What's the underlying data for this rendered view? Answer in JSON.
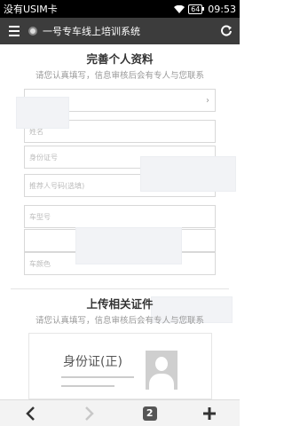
{
  "status_bar": {
    "carrier": "没有USIM卡",
    "battery": "64",
    "time": "09:53"
  },
  "browser": {
    "page_title": "一号专车线上培训系统"
  },
  "form": {
    "title": "完善个人资料",
    "subtitle": "请您认真填写，信息审核后会有专人与您联系",
    "fields": [
      {
        "placeholder": ""
      },
      {
        "placeholder": "姓名"
      },
      {
        "placeholder": "身份证号"
      },
      {
        "placeholder": "推荐人号码(选填)"
      },
      {
        "placeholder": "车型号"
      },
      {
        "placeholder": ""
      },
      {
        "placeholder": "车颜色"
      }
    ]
  },
  "upload": {
    "title": "上传相关证件",
    "subtitle": "请您认真填写，信息审核后会有专人与您联系",
    "card_label": "身份证(正)"
  },
  "toolbar": {
    "tab_count": "2"
  },
  "icons": [
    "menu-icon",
    "site-icon",
    "refresh-icon",
    "back-icon",
    "forward-icon",
    "plus-icon",
    "avatar-placeholder-icon"
  ],
  "colors": {
    "navbar": "#3c3c3c",
    "statusbar": "#000000",
    "border": "#d8d8d8"
  }
}
